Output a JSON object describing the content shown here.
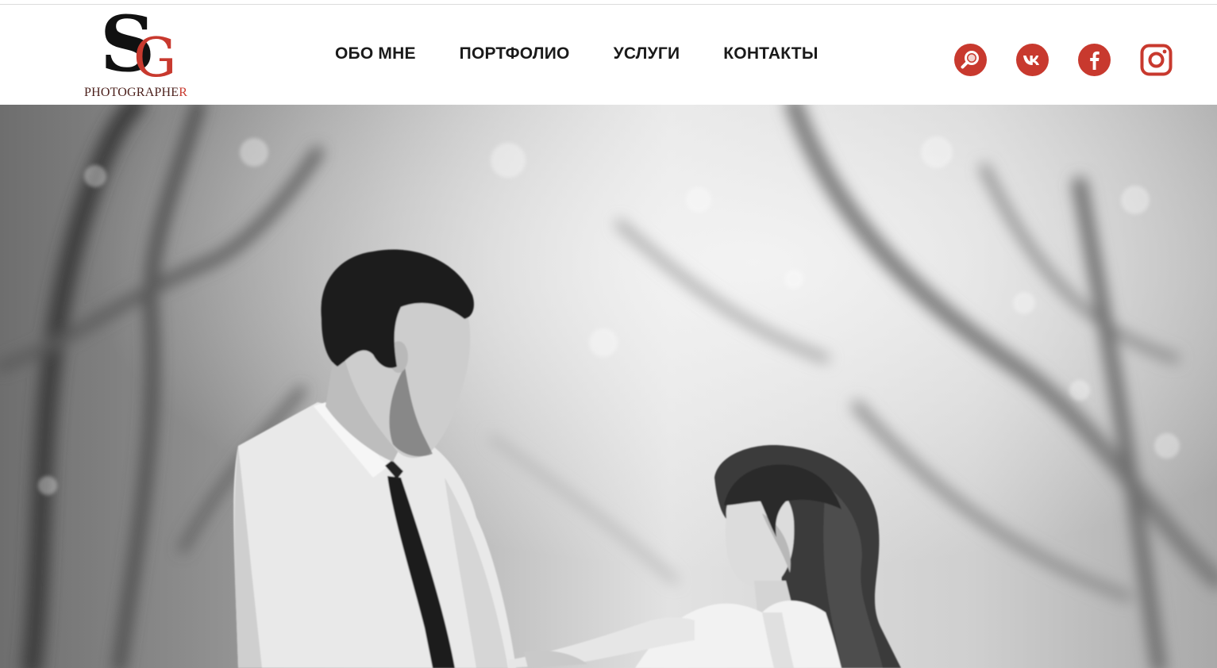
{
  "logo": {
    "letter_s": "S",
    "letter_g": "G",
    "tagline_main": "PHOTOGRAPHE",
    "tagline_end": "R"
  },
  "nav": {
    "items": [
      {
        "label": "ОБО МНЕ"
      },
      {
        "label": "ПОРТФОЛИО"
      },
      {
        "label": "УСЛУГИ"
      },
      {
        "label": "КОНТАКТЫ"
      }
    ]
  },
  "social": {
    "icons": [
      "search-icon",
      "vk-icon",
      "facebook-icon",
      "instagram-icon"
    ],
    "accent_color": "#c8392e"
  },
  "hero": {
    "description": "black and white photo"
  }
}
